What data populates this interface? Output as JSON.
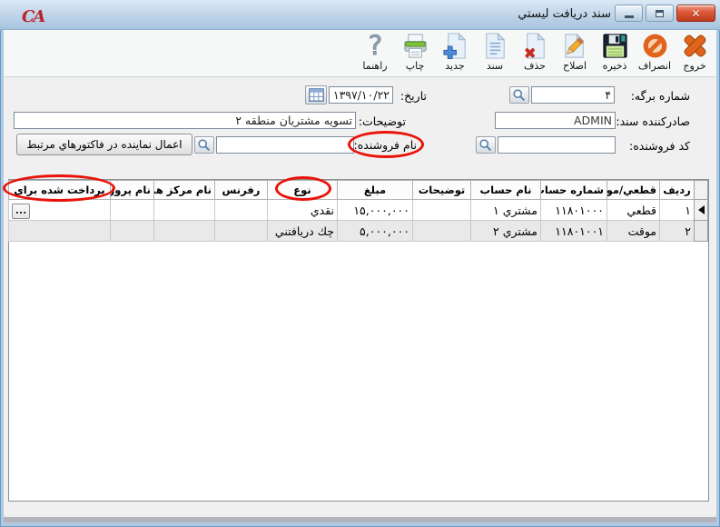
{
  "window": {
    "title": "سند دريافت ليستي",
    "logo_text": "CA"
  },
  "toolbar": {
    "buttons": [
      {
        "label": "خروج",
        "icon": "exit-icon"
      },
      {
        "label": "انصراف",
        "icon": "cancel-icon"
      },
      {
        "label": "ذخيره",
        "icon": "save-icon"
      },
      {
        "label": "اصلاح",
        "icon": "edit-icon"
      },
      {
        "label": "حذف",
        "icon": "delete-icon"
      },
      {
        "label": "سند",
        "icon": "document-icon"
      },
      {
        "label": "جديد",
        "icon": "new-icon"
      },
      {
        "label": "چاپ",
        "icon": "print-icon"
      },
      {
        "label": "راهنما",
        "icon": "help-icon"
      }
    ]
  },
  "form": {
    "sheet_no_label": "شماره برگه:",
    "sheet_no_value": "۴",
    "date_label": "تاريخ:",
    "date_value": "۱۳۹۷/۱۰/۲۲",
    "issuer_label": "صادركننده سند:",
    "issuer_value": "ADMIN",
    "description_label": "توضيحات:",
    "description_value": "تسويه مشتريان منطقه ۲",
    "seller_code_label": "كد فروشنده:",
    "seller_code_value": "",
    "seller_name_label": "نام فروشنده:",
    "seller_name_value": "",
    "apply_representative_button": "اعمال نماينده در فاكتورهاي مرتبط"
  },
  "table": {
    "columns": [
      "رديف",
      "قطعي/موقت",
      "شماره حساب",
      "نام حساب",
      "توضيحات",
      "مبلغ",
      "نوع",
      "رفرنس",
      "نام مركز هزينه",
      "نام پروژه",
      "پرداخت شده براي"
    ],
    "rows": [
      {
        "radif": "۱",
        "status": "قطعي",
        "account_no": "۱۱۸۰۱۰۰۰",
        "account_name": "مشتري ۱",
        "description": "",
        "amount": "۱۵,۰۰۰,۰۰۰",
        "type": "نقدي",
        "reference": "",
        "cost_center": "",
        "project": "",
        "paid_for": "",
        "ellipsis_button": "..."
      },
      {
        "radif": "۲",
        "status": "موقت",
        "account_no": "۱۱۸۰۱۰۰۱",
        "account_name": "مشتري ۲",
        "description": "",
        "amount": "۵,۰۰۰,۰۰۰",
        "type": "چك دريافتني",
        "reference": "",
        "cost_center": "",
        "project": "",
        "paid_for": ""
      }
    ]
  },
  "annotations": {
    "highlight_color": "#ea1208",
    "highlighted_items": [
      "نام فروشنده:",
      "نوع",
      "پرداخت شده براي"
    ]
  },
  "colors": {
    "titlebar_top": "#dce9f5",
    "titlebar_bottom": "#a8c4de",
    "frame_blue": "#aecae2",
    "toolbar_bg": "#f6f8f8",
    "client_bg": "#f0f0f0",
    "row_alt": "#e9e9e9",
    "accent_orange": "#e2641c",
    "close_red": "#c03a1c"
  }
}
